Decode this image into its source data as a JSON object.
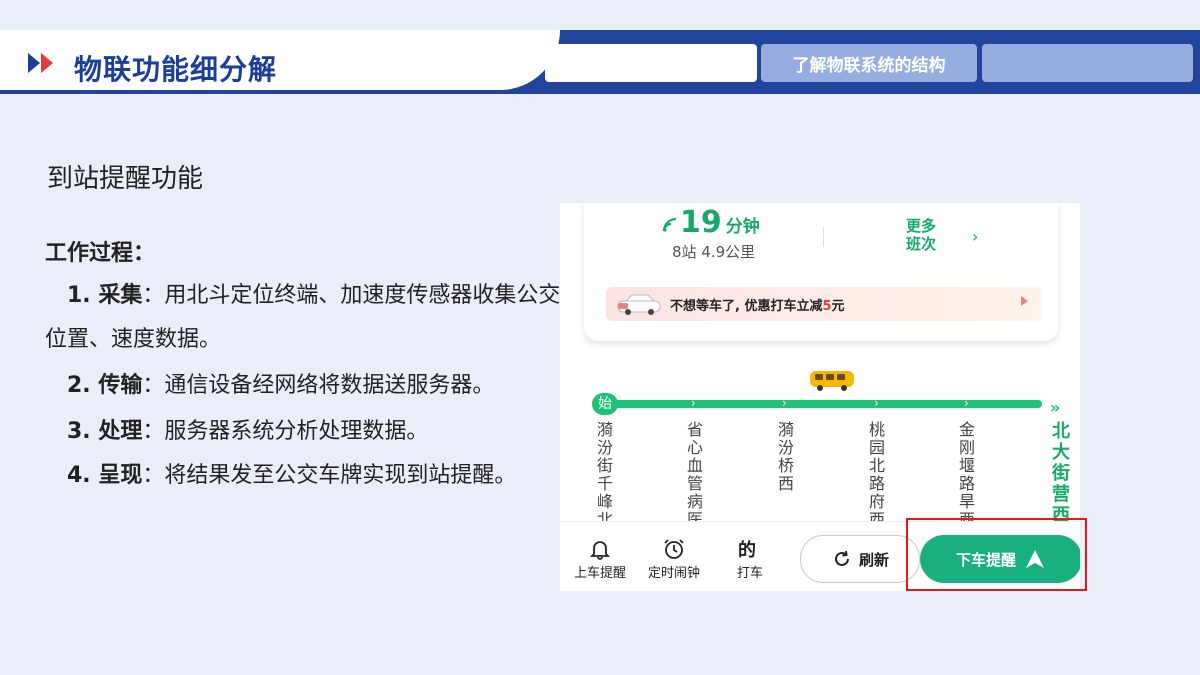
{
  "header": {
    "title": "物联功能细分解",
    "tabs": [
      {
        "label": ""
      },
      {
        "label": "了解物联系统的结构"
      },
      {
        "label": ""
      }
    ]
  },
  "content": {
    "section_title": "到站提醒功能",
    "process_label": "工作过程：",
    "steps": [
      {
        "label": "1. 采集",
        "text": "：用北斗定位终端、加速度传感器收集公交位置、速度数据。"
      },
      {
        "label": "2. 传输",
        "text": "：通信设备经网络将数据送服务器。"
      },
      {
        "label": "3. 处理",
        "text": "：服务器系统分析处理数据。"
      },
      {
        "label": "4. 呈现",
        "text": "：将结果发至公交车牌实现到站提醒。"
      }
    ]
  },
  "app": {
    "eta_number": "19",
    "eta_unit": "分钟",
    "distance": "8站   4.9公里",
    "more_line1": "更多",
    "more_line2": "班次",
    "promo_prefix": "不想等车了, 优惠打车立减",
    "promo_amount": "5",
    "promo_suffix": "元",
    "route_start": "始",
    "stops": [
      "漪汾街千峰北",
      "省心血管病医",
      "漪汾桥西",
      "桃园北路府西",
      "金刚堰路旱西"
    ],
    "end_stop": "北大街营西",
    "bottom": {
      "board_alert": "上车提醒",
      "alarm": "定时闹钟",
      "taxi": "打车",
      "refresh": "刷新",
      "alight_alert": "下车提醒"
    },
    "accent_color": "#1aaf7f"
  }
}
